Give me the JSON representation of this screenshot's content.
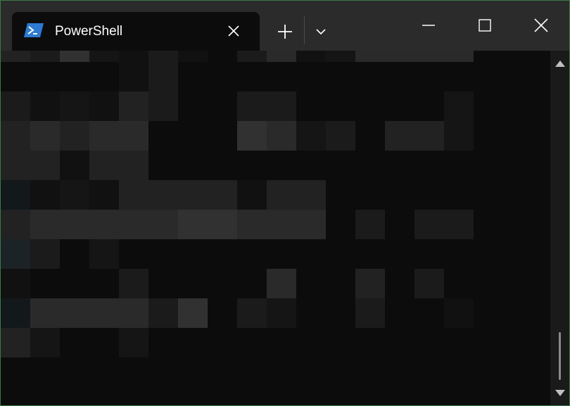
{
  "window": {
    "tab": {
      "title": "PowerShell",
      "icon": "powershell-icon"
    },
    "controls": {
      "new_tab_icon": "plus-icon",
      "dropdown_icon": "chevron-down-icon",
      "minimize_icon": "minimize-icon",
      "maximize_icon": "maximize-icon",
      "close_icon": "close-icon"
    }
  },
  "colors": {
    "titlebar_bg": "#2b2b2b",
    "terminal_bg": "#0c0c0c",
    "tab_text": "#ffffff",
    "border": "#3c7a4a",
    "icon_blue": "#2b7ad6"
  },
  "terminal": {
    "content_state": "pixelated"
  }
}
